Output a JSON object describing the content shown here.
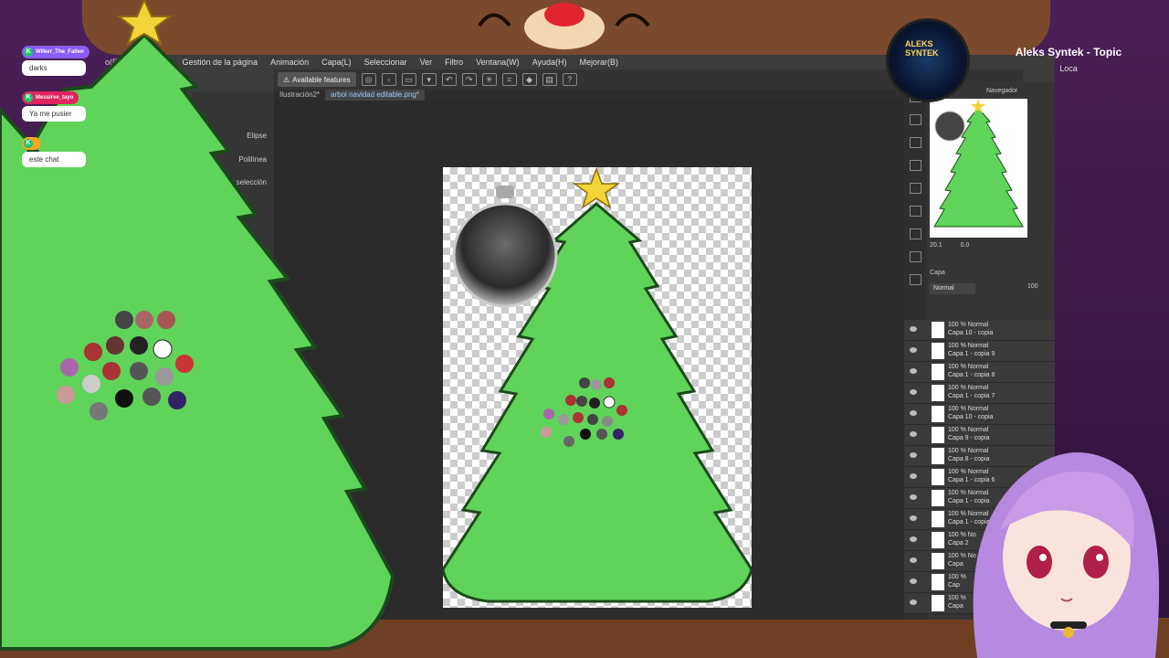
{
  "app": {
    "menus": [
      "o(F)",
      "Gestión de la página",
      "Animación",
      "Capa(L)",
      "Seleccionar",
      "Ver",
      "Filtro",
      "Ventana(W)",
      "Ayuda(H)",
      "Mejorar(B)"
    ],
    "feature_button": "Available features",
    "tabs": [
      "Ilustración2*",
      "arbol navidad editable.png*"
    ],
    "tool_options": [
      "Elipse",
      "Polilínea",
      "rrar selección"
    ],
    "navigator_title": "Navegador",
    "zoom_value": "20.1",
    "angle_value": "0.0",
    "layer_panel_title": "Capa",
    "blend_mode": "Normal",
    "opacity_value": "100",
    "layers": [
      {
        "line1": "100 % Normal",
        "line2": "Capa 10 - copia"
      },
      {
        "line1": "100 % Normal",
        "line2": "Capa 1 - copia 9"
      },
      {
        "line1": "100 % Normal",
        "line2": "Capa 1 - copia 8"
      },
      {
        "line1": "100 % Normal",
        "line2": "Capa 1 - copia 7"
      },
      {
        "line1": "100 % Normal",
        "line2": "Capa 10 - copia"
      },
      {
        "line1": "100 % Normal",
        "line2": "Capa 9 - copia"
      },
      {
        "line1": "100 % Normal",
        "line2": "Capa 8 - copia"
      },
      {
        "line1": "100 % Normal",
        "line2": "Capa 1 - copia 6"
      },
      {
        "line1": "100 % Normal",
        "line2": "Capa 1 - copia"
      },
      {
        "line1": "100 % Normal",
        "line2": "Capa 1 - copia"
      },
      {
        "line1": "100 % No",
        "line2": "Capa 2"
      },
      {
        "line1": "100 % No",
        "line2": "Capa"
      },
      {
        "line1": "100 %",
        "line2": "Cap"
      },
      {
        "line1": "100 %",
        "line2": "Capa"
      }
    ]
  },
  "now_playing": {
    "title": "Aleks Syntek - Topic",
    "subtitle": "Loca",
    "album_text": "ALEKS SYNTEK"
  },
  "chat": [
    {
      "user": "Wilker_The_Fallen",
      "text": "darks",
      "color": "#8b5cf6"
    },
    {
      "user": "Messirve_tayo",
      "text": "Ya me pusier",
      "color": "#e0245e"
    },
    {
      "user": "",
      "text": "este chat",
      "color": "#f5a623"
    }
  ],
  "colors": {
    "tree_green": "#5fd35a",
    "tree_outline": "#1c4a1c",
    "star": "#f2d43a",
    "accent_chat_badge": "#21c46a"
  }
}
